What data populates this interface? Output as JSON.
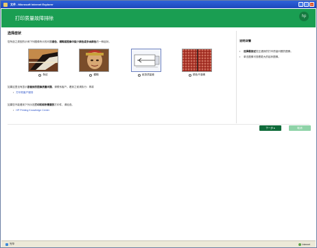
{
  "window": {
    "title": "文件 - Microsoft Internet Explorer"
  },
  "header": {
    "title": "打印质量故障排除"
  },
  "main": {
    "section_title": "选择症状",
    "intro_prefix": "您所选之类型的示例下列图像所示的问题",
    "intro_bold": "褪色、模糊或图像中缺少颜色或多余颜色",
    "intro_suffix": "的一种症状。",
    "samples": [
      {
        "label": "条纹",
        "kind": "streak"
      },
      {
        "label": "模糊",
        "kind": "blur"
      },
      {
        "label": "纸张质量差",
        "kind": "paper"
      },
      {
        "label": "颜色不准确",
        "kind": "color"
      }
    ],
    "note1_prefix": "如果这里没有显示",
    "note1_bold": "您看到的图像质量问题",
    "note1_suffix": "，请联系客户。看到之前请执行：再将",
    "link1": "打印机客户服务",
    "note2_prefix": "如果您不能看到下列示范",
    "note2_bold": "打印机和所需要的",
    "note2_suffix": "打印件，请检查。",
    "link2": "HP Printing Knowledge Center"
  },
  "side": {
    "title": "说明详情",
    "items": [
      {
        "bold": "选择最接近",
        "text": "您正遇到的打印质量问题的图像。"
      },
      {
        "bold": "",
        "text": "单击图像可查看更大的症状图像。"
      }
    ]
  },
  "buttons": {
    "next": "下一步 ▸",
    "cancel": "取消"
  },
  "status": {
    "done": "完毕",
    "zone": "Internet"
  }
}
